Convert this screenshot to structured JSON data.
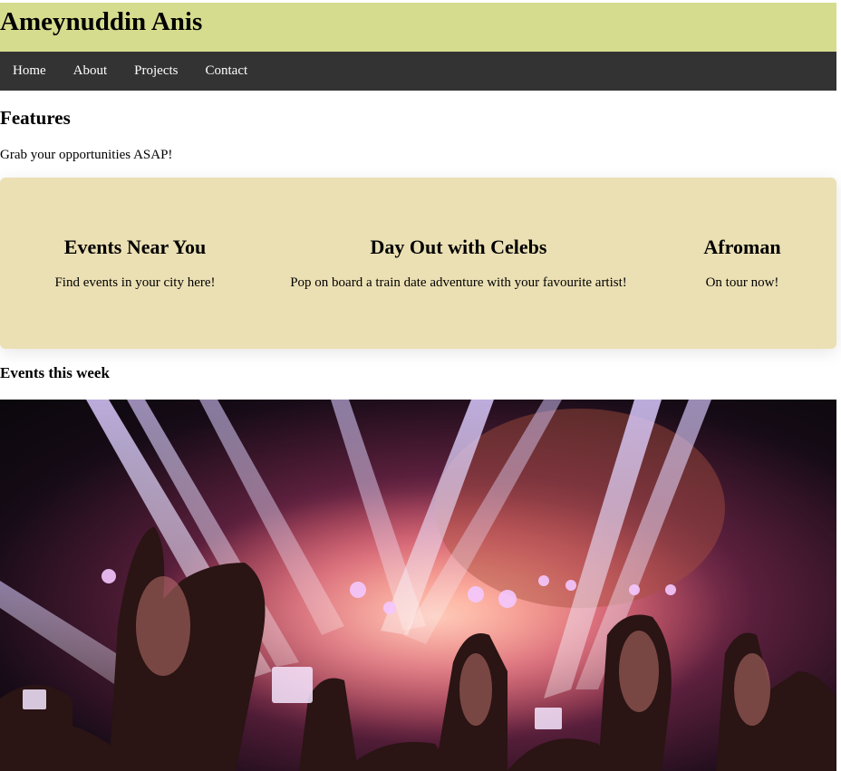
{
  "header": {
    "title": "Ameynuddin Anis"
  },
  "nav": {
    "items": [
      {
        "label": "Home"
      },
      {
        "label": "About"
      },
      {
        "label": "Projects"
      },
      {
        "label": "Contact"
      }
    ]
  },
  "features": {
    "title": "Features",
    "tagline": "Grab your opportunities ASAP!",
    "cards": [
      {
        "title": "Events Near You",
        "text": "Find events in your city here!"
      },
      {
        "title": "Day Out with Celebs",
        "text": "Pop on board a train date adventure with your favourite artist!"
      },
      {
        "title": "Afroman",
        "text": "On tour now!"
      }
    ]
  },
  "events": {
    "title": "Events this week"
  },
  "colors": {
    "header_bg": "#d6dc8e",
    "nav_bg": "#333333",
    "panel_bg": "#ebe0b4"
  }
}
